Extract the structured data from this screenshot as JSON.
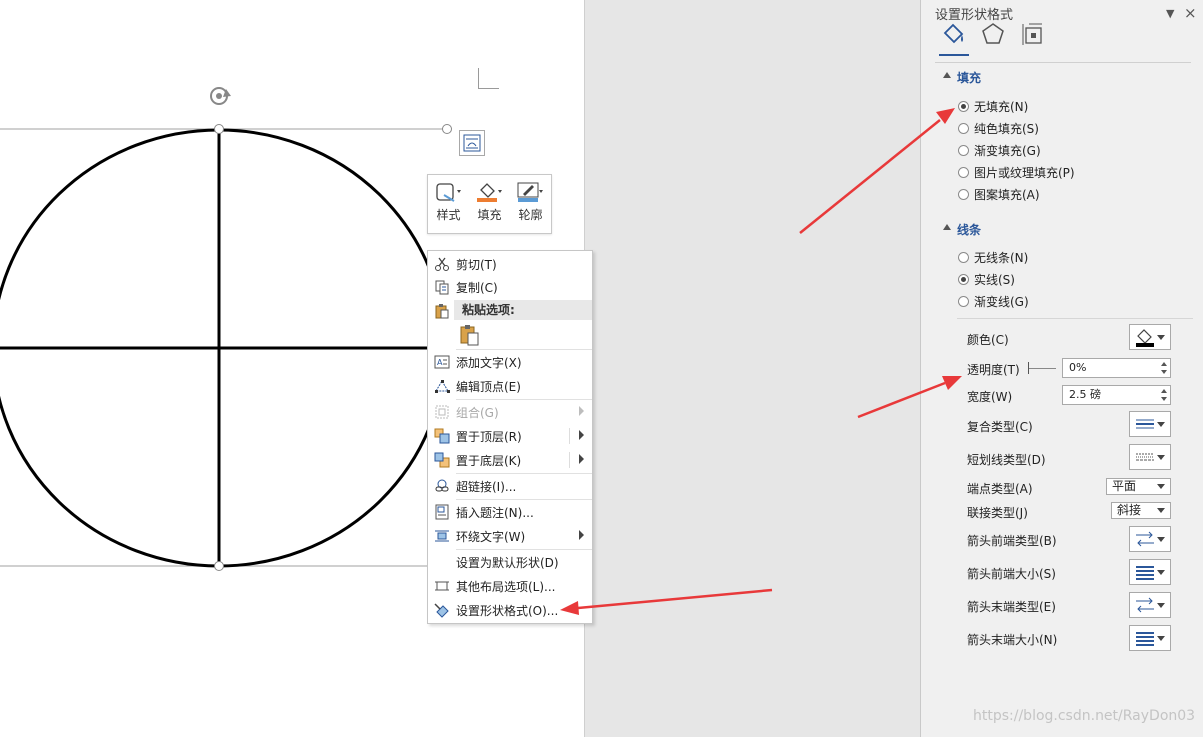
{
  "colors": {
    "accent": "#2b579a",
    "arrow": "#e8393a",
    "fill_orange": "#ed7d31",
    "line_blue": "#5b9bd5"
  },
  "mini_toolbar": {
    "style_label": "样式",
    "fill_label": "填充",
    "outline_label": "轮廓"
  },
  "context_menu": {
    "cut": "剪切(T)",
    "copy": "复制(C)",
    "paste_options": "粘贴选项:",
    "add_text": "添加文字(X)",
    "edit_points": "编辑顶点(E)",
    "group": "组合(G)",
    "bring_to_front": "置于顶层(R)",
    "send_to_back": "置于底层(K)",
    "hyperlink": "超链接(I)...",
    "insert_caption": "插入题注(N)...",
    "wrap_text": "环绕文字(W)",
    "set_default": "设置为默认形状(D)",
    "more_layout": "其他布局选项(L)...",
    "format_shape": "设置形状格式(O)..."
  },
  "panel": {
    "title": "设置形状格式",
    "fill": {
      "header": "填充",
      "options": [
        "无填充(N)",
        "纯色填充(S)",
        "渐变填充(G)",
        "图片或纹理填充(P)",
        "图案填充(A)"
      ],
      "selected": "无填充(N)"
    },
    "line": {
      "header": "线条",
      "options": [
        "无线条(N)",
        "实线(S)",
        "渐变线(G)"
      ],
      "selected": "实线(S)"
    },
    "props": {
      "color_label": "颜色(C)",
      "transparency_label": "透明度(T)",
      "transparency_value": "0%",
      "width_label": "宽度(W)",
      "width_value": "2.5 磅",
      "compound_label": "复合类型(C)",
      "dash_label": "短划线类型(D)",
      "cap_label": "端点类型(A)",
      "cap_value": "平面",
      "join_label": "联接类型(J)",
      "join_value": "斜接",
      "begin_arrow_type_label": "箭头前端类型(B)",
      "begin_arrow_size_label": "箭头前端大小(S)",
      "end_arrow_type_label": "箭头末端类型(E)",
      "end_arrow_size_label": "箭头末端大小(N)"
    }
  },
  "watermark": "https://blog.csdn.net/RayDon03"
}
